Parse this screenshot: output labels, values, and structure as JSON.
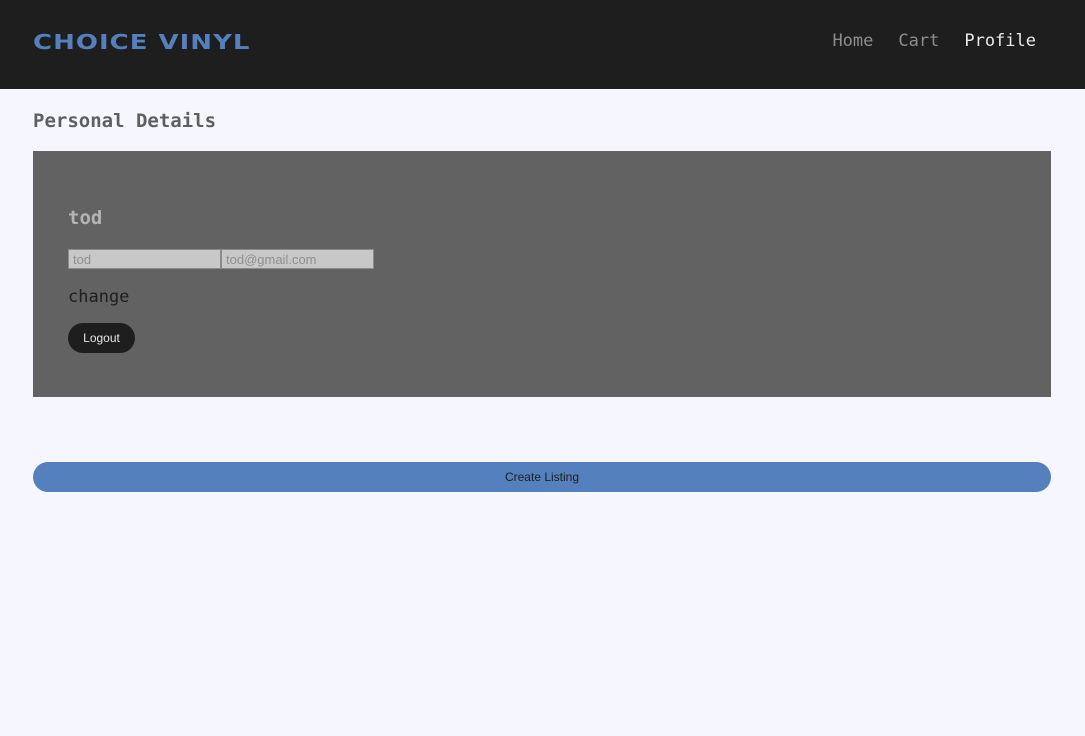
{
  "brand": {
    "logo_text": "CHOICE VINYL",
    "accent_color": "#5480be",
    "navbar_color": "#1e1e1e"
  },
  "nav": {
    "items": [
      {
        "label": "Home",
        "active": false
      },
      {
        "label": "Cart",
        "active": false
      },
      {
        "label": "Profile",
        "active": true
      }
    ]
  },
  "profile": {
    "section_title": "Personal Details",
    "username": "tod",
    "name_field": {
      "value": "",
      "placeholder": "tod"
    },
    "email_field": {
      "value": "",
      "placeholder": "tod@gmail.com"
    },
    "change_label": "change",
    "logout_label": "Logout"
  },
  "actions": {
    "create_listing_label": "Create Listing"
  }
}
